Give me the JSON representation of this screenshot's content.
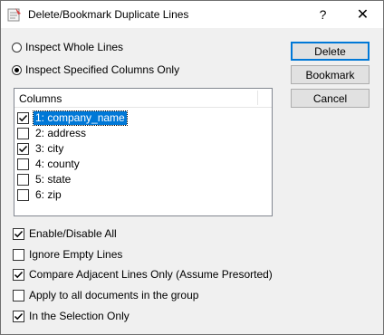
{
  "window": {
    "title": "Delete/Bookmark Duplicate Lines",
    "help_label": "?",
    "close_label": "✕"
  },
  "mode": {
    "whole_lines": {
      "label": "Inspect Whole Lines",
      "selected": false
    },
    "specified_columns": {
      "label": "Inspect Specified Columns Only",
      "selected": true
    }
  },
  "buttons": {
    "delete": "Delete",
    "bookmark": "Bookmark",
    "cancel": "Cancel"
  },
  "columns": {
    "header": "Columns",
    "items": [
      {
        "label": "1: company_name",
        "checked": true,
        "selected": true
      },
      {
        "label": "2: address",
        "checked": false,
        "selected": false
      },
      {
        "label": "3: city",
        "checked": true,
        "selected": false
      },
      {
        "label": "4: county",
        "checked": false,
        "selected": false
      },
      {
        "label": "5: state",
        "checked": false,
        "selected": false
      },
      {
        "label": "6: zip",
        "checked": false,
        "selected": false
      }
    ]
  },
  "options": {
    "enable_disable_all": {
      "label": "Enable/Disable All",
      "checked": true
    },
    "ignore_empty": {
      "label": "Ignore Empty Lines",
      "checked": false
    },
    "compare_adjacent": {
      "label": "Compare Adjacent Lines Only (Assume Presorted)",
      "checked": true
    },
    "apply_all_docs": {
      "label": "Apply to all documents in the group",
      "checked": false
    },
    "selection_only": {
      "label": "In the Selection Only",
      "checked": true
    }
  }
}
